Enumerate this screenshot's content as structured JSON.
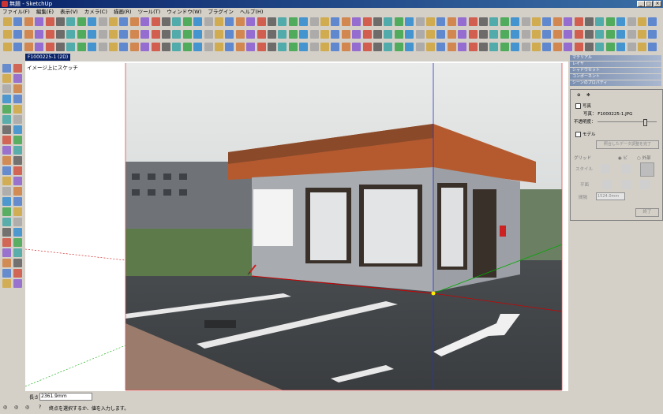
{
  "window": {
    "title": "無題 - SketchUp"
  },
  "menu": [
    "ファイル(F)",
    "編集(E)",
    "表示(V)",
    "カメラ(C)",
    "描画(R)",
    "ツール(T)",
    "ウィンドウ(W)",
    "プラグイン",
    "ヘルプ(H)"
  ],
  "scene_tab": "F1000225-1 (2D)",
  "canvas_label": "イメージ上にスケッチ",
  "right_panel": {
    "headers": [
      "マテリアル",
      "レイヤ",
      "シャドウセット",
      "コンポーネント",
      "シーンのプロパティ"
    ],
    "dialog": {
      "photo_checkbox": "写真",
      "photo_label": "写真：",
      "photo_file": "F1000225-1.JPG",
      "opacity_label": "不透明度：",
      "model_checkbox": "モデル",
      "match_button": "照合したデータ調整を完了",
      "grid_label": "グリッド",
      "style_label": "スタイル",
      "plane_label": "平面",
      "spacing_label": "間隔",
      "spacing_value": "1524.0mm",
      "radio_a": "ビ",
      "radio_b": "外部",
      "done_button": "終了"
    }
  },
  "status": {
    "length_label": "長さ",
    "length_value": "2361.9mm",
    "hint": "終点を選択するか、値を入力します。"
  },
  "colors": {
    "accent_green": "#22aa22",
    "accent_red": "#dd2222",
    "axis_red": "#cc0000",
    "axis_green": "#00aa00",
    "axis_blue": "#0000cc"
  }
}
